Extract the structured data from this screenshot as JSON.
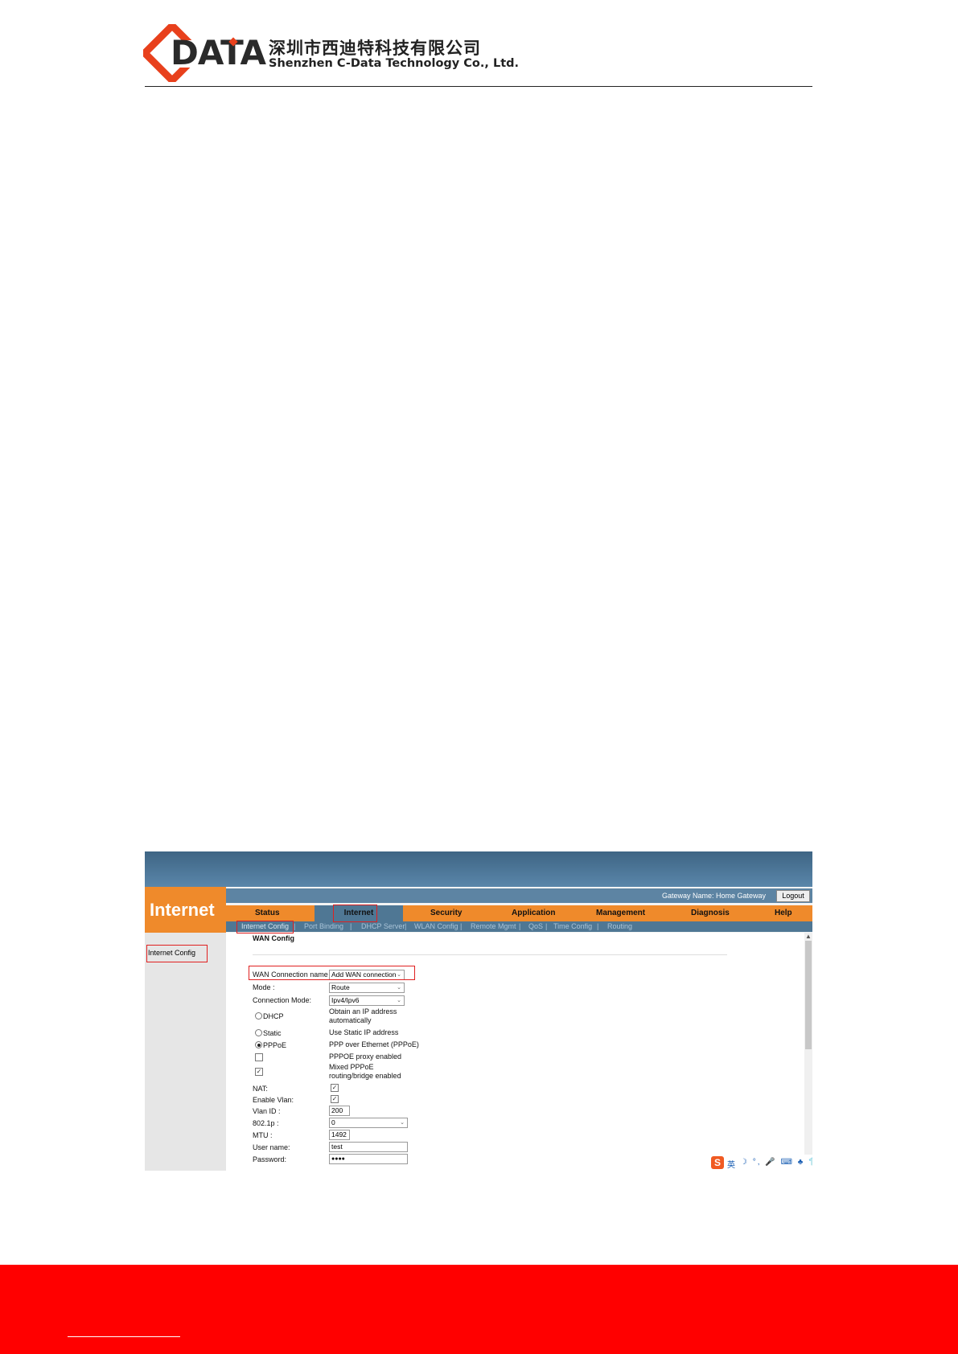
{
  "header": {
    "logo_text": "DATA",
    "company_cn": "深圳市西迪特科技有限公司",
    "company_en": "Shenzhen C-Data Technology Co., Ltd."
  },
  "screenshot": {
    "gateway_label": "Gateway Name: Home Gateway",
    "logout_label": "Logout",
    "section_title": "Internet",
    "nav": [
      "Status",
      "Internet",
      "Security",
      "Application",
      "Management",
      "Diagnosis",
      "Help"
    ],
    "active_nav": "Internet",
    "subnav": [
      "Internet Config",
      "Port Binding",
      "DHCP Server",
      "WLAN Config",
      "Remote Mgmt",
      "QoS",
      "Time Config",
      "Routing"
    ],
    "subnav_sep": "|",
    "sidebar_item": "Internet Config",
    "page_title": "WAN Config",
    "form": {
      "wan_conn_label": "WAN Connection name",
      "wan_conn_value": "Add WAN connection",
      "mode_label": "Mode :",
      "mode_value": "Route",
      "conn_mode_label": "Connection Mode:",
      "conn_mode_value": "Ipv4/Ipv6",
      "dhcp_label": "DHCP",
      "dhcp_desc_1": "Obtain an IP address",
      "dhcp_desc_2": "automatically",
      "static_label": "Static",
      "static_desc": "Use Static IP address",
      "pppoe_label": "PPPoE",
      "pppoe_desc": "PPP over Ethernet (PPPoE)",
      "proxy_desc": "PPPOE proxy enabled",
      "mixed_desc_1": "Mixed PPPoE",
      "mixed_desc_2": "routing/bridge enabled",
      "nat_label": "NAT:",
      "vlan_label": "Enable Vlan:",
      "vlan_id_label": "Vlan ID :",
      "vlan_id_value": "200",
      "dot1p_label": "802.1p :",
      "dot1p_value": "0",
      "mtu_label": "MTU :",
      "mtu_value": "1492",
      "user_label": "User name:",
      "user_value": "test",
      "pass_label": "Password:",
      "pass_value": "●●●●"
    },
    "ime": {
      "logo": "S",
      "lang": "英",
      "icons": "☽ °, 🎤 ⌨ ♣ 👕 🔧"
    }
  }
}
